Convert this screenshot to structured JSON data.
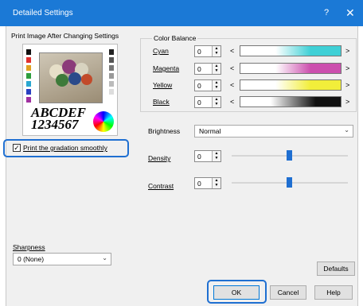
{
  "window": {
    "title": "Detailed Settings",
    "help": "?",
    "close": "✕"
  },
  "preview": {
    "label": "Print Image After Changing Settings",
    "text_line1": "ABCDEF",
    "text_line2": "1234567"
  },
  "gradation": {
    "label": "Print the gradation smoothly",
    "checked": true
  },
  "color_balance": {
    "title": "Color Balance",
    "rows": [
      {
        "label": "Cyan",
        "value": "0",
        "color": "#3fd0d6"
      },
      {
        "label": "Magenta",
        "value": "0",
        "color": "#cc4fae"
      },
      {
        "label": "Yellow",
        "value": "0",
        "color": "#f2ee3a"
      },
      {
        "label": "Black",
        "value": "0",
        "color": "#111111"
      }
    ]
  },
  "brightness": {
    "label": "Brightness",
    "value": "Normal"
  },
  "density": {
    "label": "Density",
    "value": "0"
  },
  "contrast": {
    "label": "Contrast",
    "value": "0"
  },
  "sharpness": {
    "label": "Sharpness",
    "value": "0 (None)"
  },
  "buttons": {
    "defaults": "Defaults",
    "ok": "OK",
    "cancel": "Cancel",
    "help": "Help"
  },
  "accent_color": "#1f6fd1"
}
